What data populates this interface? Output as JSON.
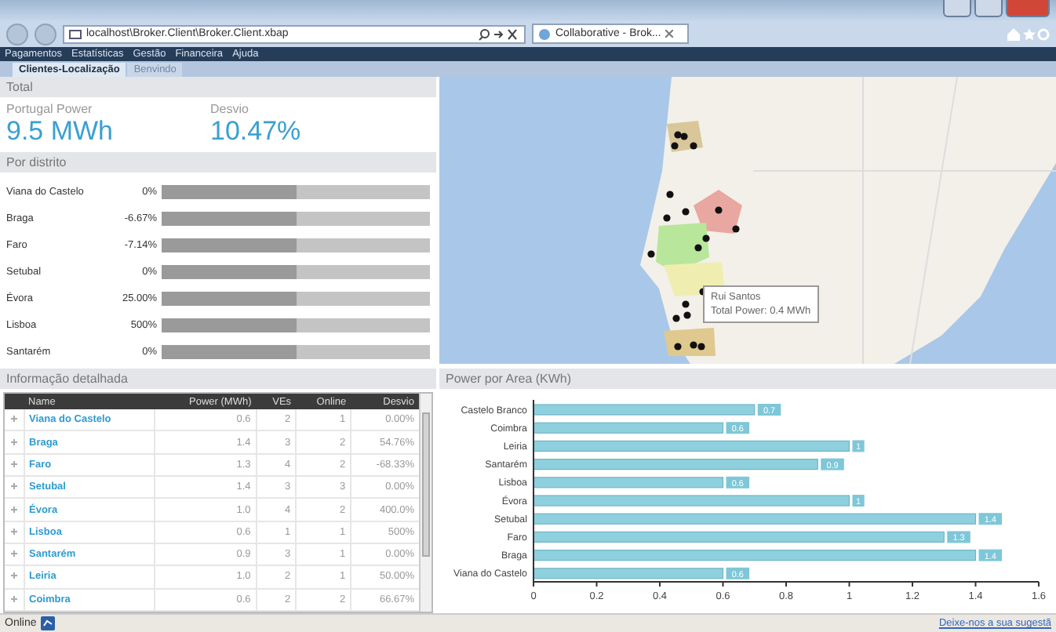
{
  "browser": {
    "address": "localhost\\Broker.Client\\Broker.Client.xbap",
    "tabs": [
      {
        "label": "Collaborative - Brok...",
        "selected": true
      }
    ]
  },
  "menu": [
    "Pagamentos",
    "Estatísticas",
    "Gestão",
    "Financeira",
    "Ajuda"
  ],
  "page_tabs": [
    {
      "label": "Clientes-Localização",
      "selected": true
    },
    {
      "label": "Benvindo",
      "selected": false
    }
  ],
  "total": {
    "title": "Total",
    "metrics": [
      {
        "label": "Portugal Power",
        "value": "9.5 MWh"
      },
      {
        "label": "Desvio",
        "value": "10.47%"
      }
    ]
  },
  "por_distrito": {
    "title": "Por distrito",
    "rows": [
      {
        "name": "Viana do Castelo",
        "reading": "0%",
        "level": 0.5
      },
      {
        "name": "Braga",
        "reading": "-6.67%",
        "level": 0.5
      },
      {
        "name": "Faro",
        "reading": "-7.14%",
        "level": 0.5
      },
      {
        "name": "Setubal",
        "reading": "0%",
        "level": 0.5
      },
      {
        "name": "Évora",
        "reading": "25.00%",
        "level": 0.5
      },
      {
        "name": "Lisboa",
        "reading": "500%",
        "level": 0.5
      },
      {
        "name": "Santarém",
        "reading": "0%",
        "level": 0.5
      }
    ]
  },
  "map": {
    "tooltip": {
      "title": "Rui Santos",
      "text": "Total Power: 0.4 MWh"
    }
  },
  "detail": {
    "title": "Informação detalhada",
    "columns": [
      "Name",
      "Power (MWh)",
      "VEs",
      "Online",
      "Desvio"
    ],
    "rows": [
      {
        "cells": [
          "Viana do Castelo",
          "0.6",
          "2",
          "1",
          "0.00%"
        ]
      },
      {
        "cells": [
          "Braga",
          "1.4",
          "3",
          "2",
          "54.76%"
        ]
      },
      {
        "cells": [
          "Faro",
          "1.3",
          "4",
          "2",
          "-68.33%"
        ]
      },
      {
        "cells": [
          "Setubal",
          "1.4",
          "3",
          "3",
          "0.00%"
        ]
      },
      {
        "cells": [
          "Évora",
          "1.0",
          "4",
          "2",
          "400.0%"
        ]
      },
      {
        "cells": [
          "Lisboa",
          "0.6",
          "1",
          "1",
          "500%"
        ]
      },
      {
        "cells": [
          "Santarém",
          "0.9",
          "3",
          "1",
          "0.00%"
        ]
      },
      {
        "cells": [
          "Leiria",
          "1.0",
          "2",
          "1",
          "50.00%"
        ]
      },
      {
        "cells": [
          "Coimbra",
          "0.6",
          "2",
          "2",
          "66.67%"
        ]
      }
    ]
  },
  "chart_panel": {
    "title": "Power por Area (KWh)",
    "chart_data": {
      "type": "bar",
      "orientation": "horizontal",
      "categories": [
        "Castelo Branco",
        "Coimbra",
        "Leiria",
        "Santarém",
        "Lisboa",
        "Évora",
        "Setubal",
        "Faro",
        "Braga",
        "Viana do Castelo"
      ],
      "series": [
        {
          "color": "#8fd0de",
          "values": [
            0.7,
            0.6,
            1,
            0.9,
            0.6,
            1,
            1.4,
            1.3,
            1.4,
            0.6
          ]
        }
      ],
      "xlim": [
        0,
        1.6
      ],
      "xticks": [
        0,
        0.2,
        0.4,
        0.6,
        0.8,
        1,
        1.2,
        1.4,
        1.6
      ],
      "data_labels": true
    }
  },
  "status_bar": {
    "status": "Online",
    "link": "Deixe-nos a sua sugestã"
  }
}
